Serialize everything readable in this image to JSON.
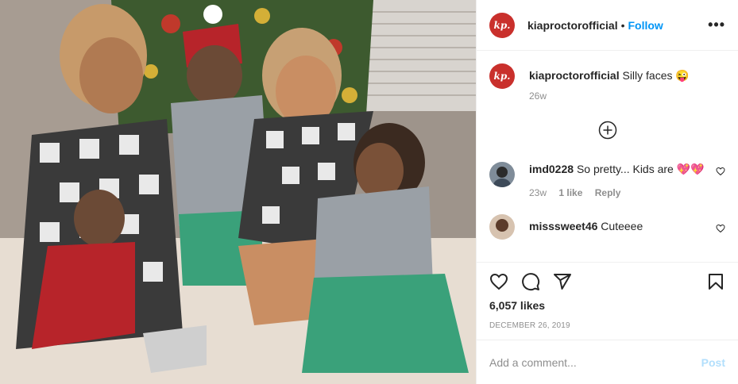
{
  "header": {
    "avatar_text": "kp.",
    "username": "kiaproctorofficial",
    "dot": "•",
    "follow": "Follow",
    "more": "•••"
  },
  "caption": {
    "avatar_text": "kp.",
    "username": "kiaproctorofficial",
    "text": "Silly faces 😜",
    "time": "26w"
  },
  "comments": [
    {
      "username": "imd0228",
      "text": "So pretty... Kids are",
      "hearts": "💖💖",
      "time": "23w",
      "likes": "1 like",
      "reply": "Reply"
    },
    {
      "username": "misssweet46",
      "text": "Cuteeee"
    }
  ],
  "actions": {
    "likes": "6,057 likes",
    "date": "December 26, 2019"
  },
  "add_comment": {
    "placeholder": "Add a comment...",
    "post": "Post"
  },
  "colors": {
    "brand_red": "#c9302c",
    "link_blue": "#0095f6",
    "post_disabled": "#b2dffc"
  },
  "icons": [
    "heart-icon",
    "comment-icon",
    "share-icon",
    "bookmark-icon",
    "add-circle-icon",
    "more-icon"
  ]
}
